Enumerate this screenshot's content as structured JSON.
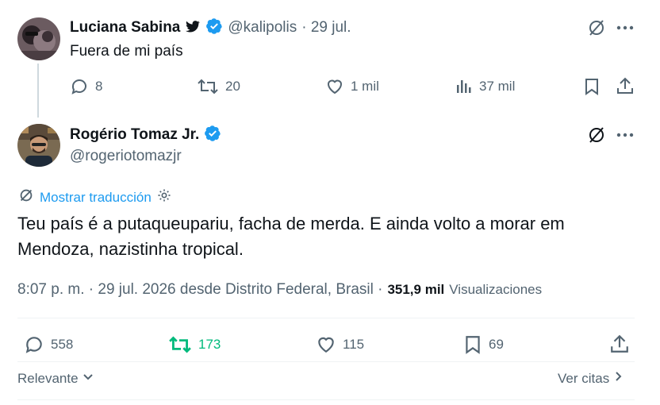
{
  "reply_tweet": {
    "author_name": "Luciana Sabina",
    "handle": "@kalipolis",
    "date": "· 29 jul.",
    "text": "Fuera de mi país",
    "replies": "8",
    "retweets": "20",
    "likes": "1 mil",
    "views": "37 mil"
  },
  "main_tweet": {
    "author_name": "Rogério Tomaz Jr.",
    "handle": "@rogeriotomazjr",
    "translate_label": "Mostrar traducción",
    "text_line1": "Teu país é a putaqueupariu, facha de merda. E ainda volto a morar em",
    "text_line2": "Mendoza, nazistinha tropical.",
    "timestamp": "8:07 p. m. · 29 jul. 2026 desde Distrito Federal, Brasil ·",
    "views_count": "351,9 mil",
    "views_label": "Visualizaciones",
    "replies": "558",
    "retweets": "173",
    "likes": "115",
    "bookmarks": "69"
  },
  "footer": {
    "sort_label": "Relevante",
    "quotes_label": "Ver citas"
  },
  "colors": {
    "accent_blue": "#1d9bf0",
    "retweet_green": "#00ba7c",
    "muted": "#536471",
    "text": "#0f1419"
  }
}
